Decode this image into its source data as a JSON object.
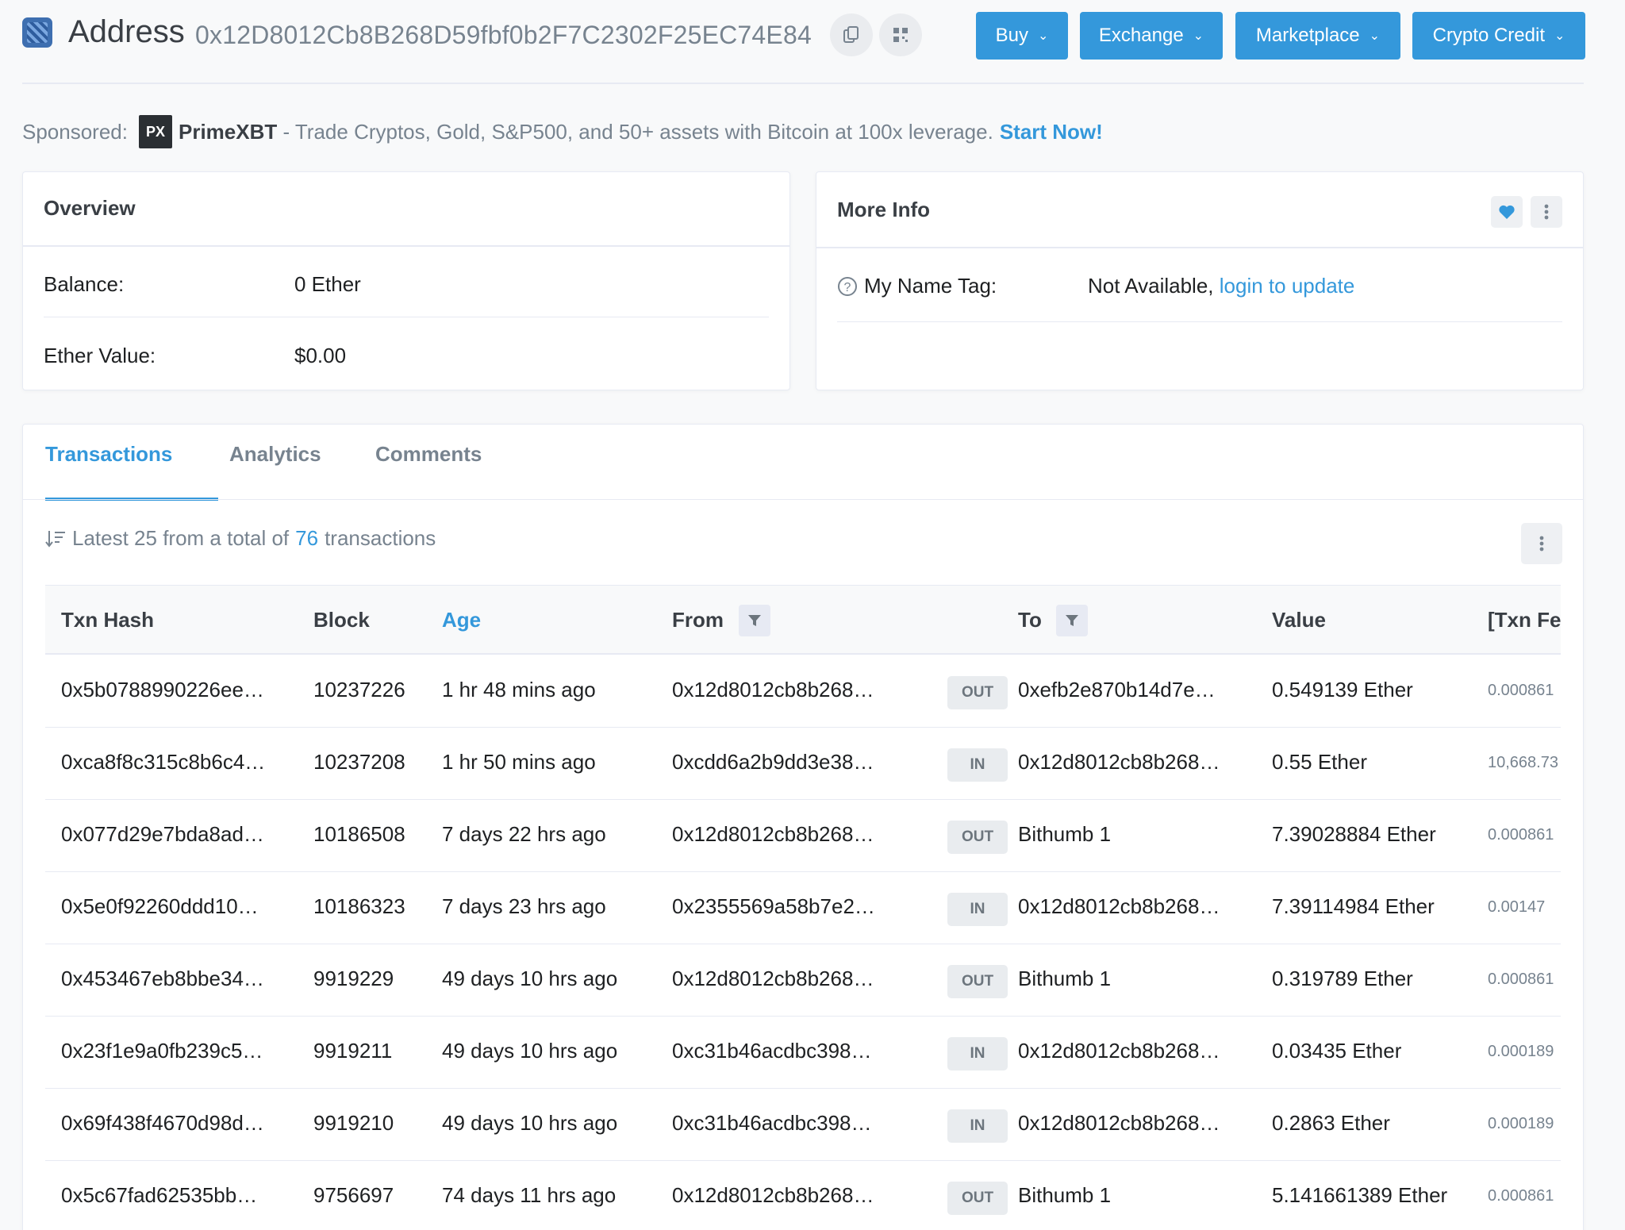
{
  "header": {
    "title": "Address",
    "address": "0x12D8012Cb8B268D59fbf0b2F7C2302F25EC74E84",
    "nav": [
      {
        "label": "Buy"
      },
      {
        "label": "Exchange"
      },
      {
        "label": "Marketplace"
      },
      {
        "label": "Crypto Credit"
      }
    ]
  },
  "sponsor": {
    "prefix": "Sponsored:",
    "logo_text": "PX",
    "name": "PrimeXBT",
    "text": " - Trade Cryptos, Gold, S&P500, and 50+ assets with Bitcoin at 100x leverage.",
    "cta": "Start Now!"
  },
  "overview": {
    "title": "Overview",
    "balance_label": "Balance:",
    "balance_value": "0 Ether",
    "ether_value_label": "Ether Value:",
    "ether_value": "$0.00"
  },
  "more_info": {
    "title": "More Info",
    "name_tag_label": "My Name Tag:",
    "name_tag_value": "Not Available,",
    "name_tag_link": "login to update"
  },
  "tabs": [
    {
      "label": "Transactions"
    },
    {
      "label": "Analytics"
    },
    {
      "label": "Comments"
    }
  ],
  "summary": {
    "prefix": "Latest 25 from a total of",
    "count": "76",
    "suffix": "transactions"
  },
  "table": {
    "columns": {
      "hash": "Txn Hash",
      "block": "Block",
      "age": "Age",
      "from": "From",
      "to": "To",
      "value": "Value",
      "fee": "[Txn Fe"
    },
    "rows": [
      {
        "hash": "0x5b0788990226ee…",
        "block": "10237226",
        "age": "1 hr 48 mins ago",
        "from": "0x12d8012cb8b268…",
        "dir": "OUT",
        "to": "0xefb2e870b14d7e…",
        "value": "0.549139 Ether",
        "fee": "0.000861"
      },
      {
        "hash": "0xca8f8c315c8b6c4…",
        "block": "10237208",
        "age": "1 hr 50 mins ago",
        "from": "0xcdd6a2b9dd3e38…",
        "dir": "IN",
        "to": "0x12d8012cb8b268…",
        "value": "0.55 Ether",
        "fee": "10,668.73"
      },
      {
        "hash": "0x077d29e7bda8ad…",
        "block": "10186508",
        "age": "7 days 22 hrs ago",
        "from": "0x12d8012cb8b268…",
        "dir": "OUT",
        "to": "Bithumb 1",
        "value": "7.39028884 Ether",
        "fee": "0.000861"
      },
      {
        "hash": "0x5e0f92260ddd10…",
        "block": "10186323",
        "age": "7 days 23 hrs ago",
        "from": "0x2355569a58b7e2…",
        "dir": "IN",
        "to": "0x12d8012cb8b268…",
        "value": "7.39114984 Ether",
        "fee": "0.00147"
      },
      {
        "hash": "0x453467eb8bbe34…",
        "block": "9919229",
        "age": "49 days 10 hrs ago",
        "from": "0x12d8012cb8b268…",
        "dir": "OUT",
        "to": "Bithumb 1",
        "value": "0.319789 Ether",
        "fee": "0.000861"
      },
      {
        "hash": "0x23f1e9a0fb239c5…",
        "block": "9919211",
        "age": "49 days 10 hrs ago",
        "from": "0xc31b46acdbc398…",
        "dir": "IN",
        "to": "0x12d8012cb8b268…",
        "value": "0.03435 Ether",
        "fee": "0.000189"
      },
      {
        "hash": "0x69f438f4670d98d…",
        "block": "9919210",
        "age": "49 days 10 hrs ago",
        "from": "0xc31b46acdbc398…",
        "dir": "IN",
        "to": "0x12d8012cb8b268…",
        "value": "0.2863 Ether",
        "fee": "0.000189"
      },
      {
        "hash": "0x5c67fad62535bb…",
        "block": "9756697",
        "age": "74 days 11 hrs ago",
        "from": "0x12d8012cb8b268…",
        "dir": "OUT",
        "to": "Bithumb 1",
        "value": "5.141661389 Ether",
        "fee": "0.000861"
      }
    ]
  },
  "colors": {
    "accent": "#3498db",
    "text_muted": "#77838f",
    "badge_bg": "#e9ecef"
  }
}
